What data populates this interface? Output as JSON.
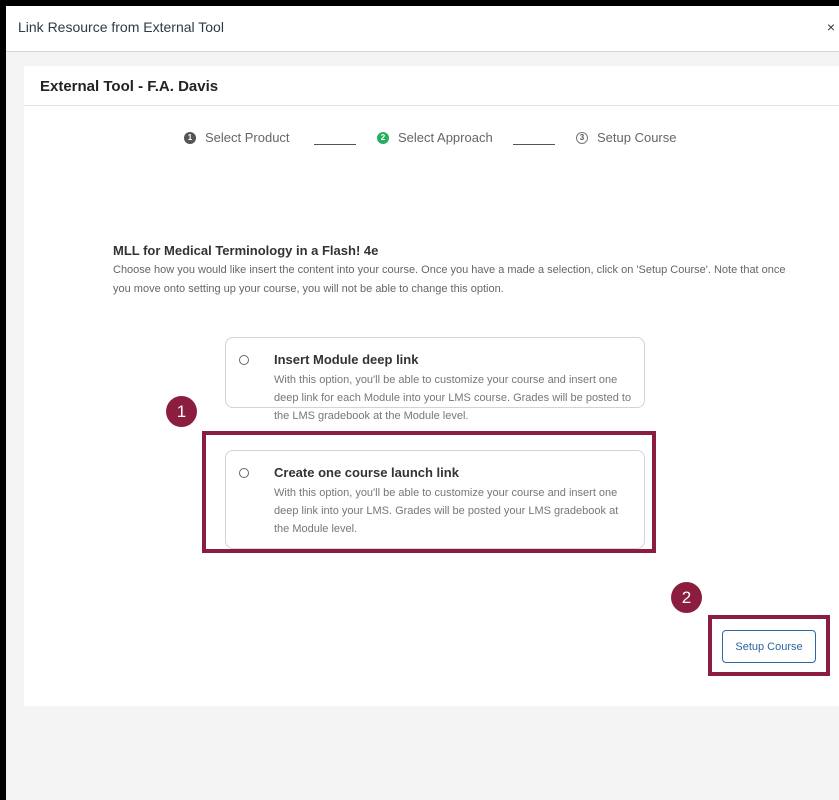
{
  "dialog": {
    "title": "Link Resource from External Tool",
    "close_label": "×"
  },
  "panel": {
    "title": "External Tool - F.A. Davis"
  },
  "stepper": {
    "steps": [
      {
        "number": "1",
        "label": "Select Product",
        "state": "done"
      },
      {
        "number": "2",
        "label": "Select Approach",
        "state": "active"
      },
      {
        "number": "3",
        "label": "Setup Course",
        "state": "future"
      }
    ]
  },
  "content": {
    "title": "MLL for Medical Terminology in a Flash! 4e",
    "description": "Choose how you would like insert the content into your course. Once you have a made a selection, click on 'Setup Course'. Note that once you move onto setting up your course, you will not be able to change this option."
  },
  "options": [
    {
      "title": "Insert Module deep link",
      "description": "With this option, you'll be able to customize your course and insert one deep link for each Module into your LMS course. Grades will be posted to the LMS gradebook at the Module level."
    },
    {
      "title": "Create one course launch link",
      "description": "With this option, you'll be able to customize your course and insert one deep link into your LMS. Grades will be posted your LMS gradebook at the Module level."
    }
  ],
  "actions": {
    "setup_label": "Setup Course"
  },
  "callouts": [
    "1",
    "2"
  ],
  "colors": {
    "highlight": "#8b1e3f",
    "active_step": "#27ae60",
    "button_border": "#2d6aa5"
  }
}
